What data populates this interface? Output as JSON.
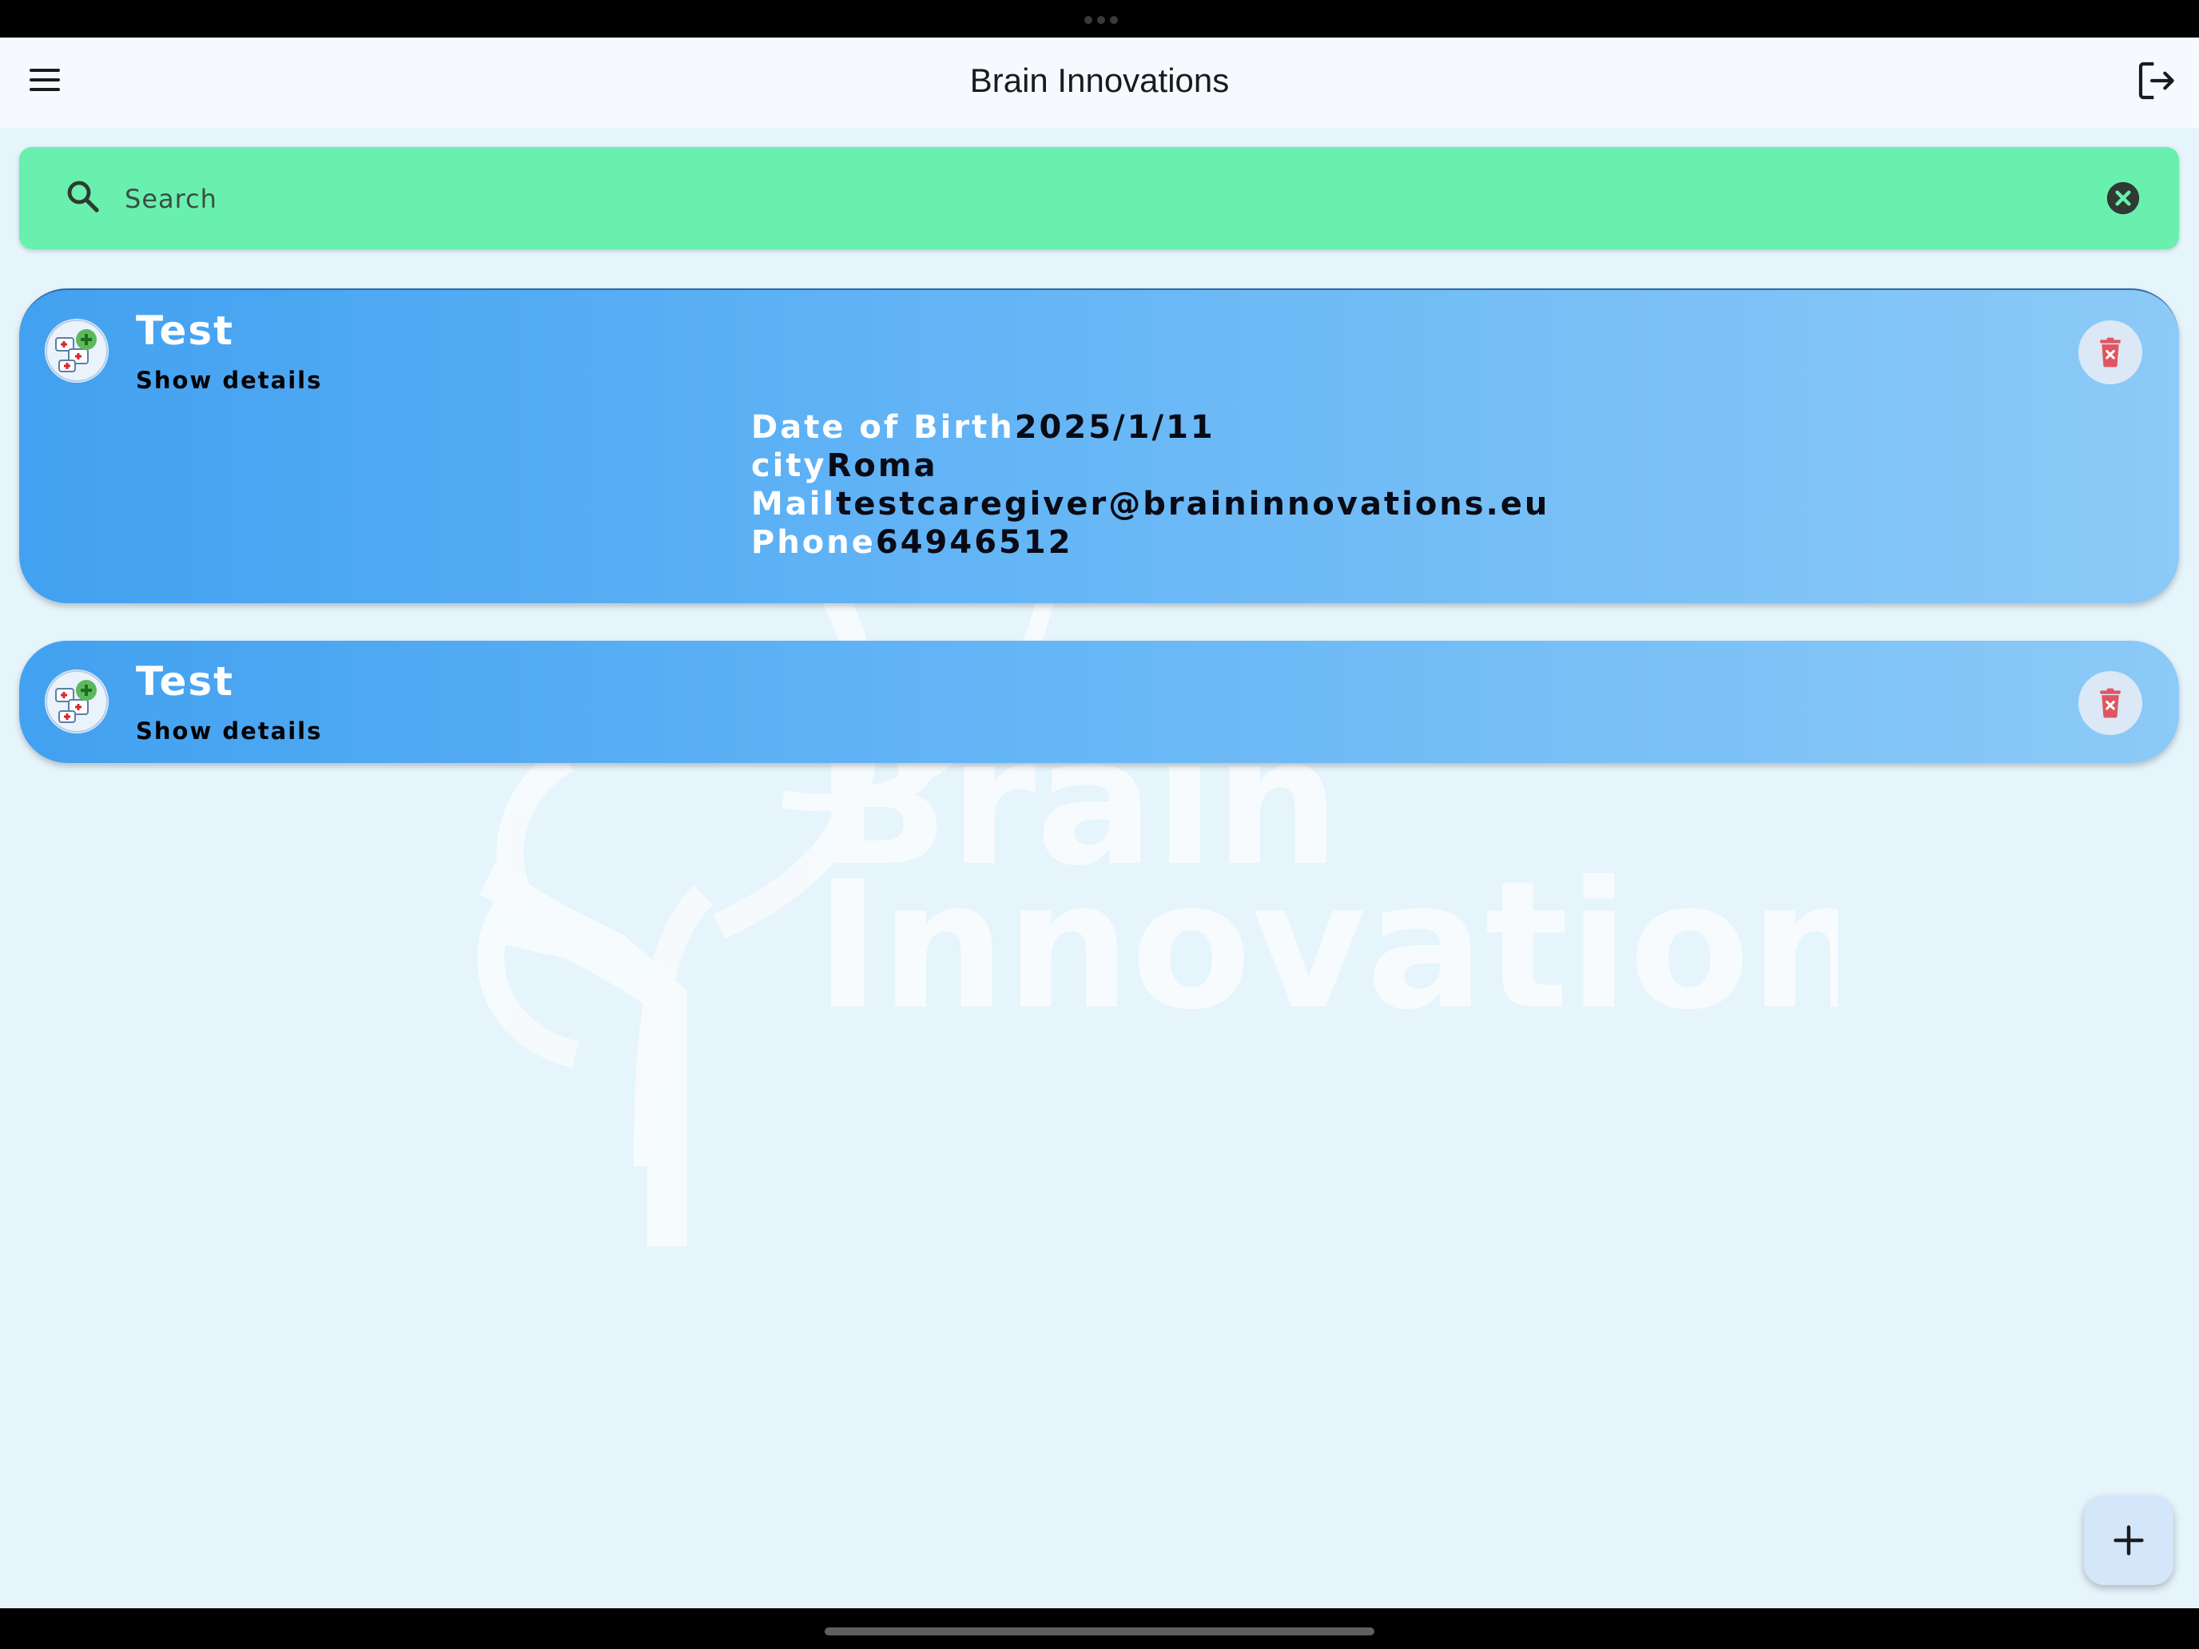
{
  "app_bar": {
    "title": "Brain Innovations",
    "menu_icon": "menu-icon",
    "logout_icon": "logout-icon"
  },
  "watermark": {
    "line1": "Brain",
    "line2": "Innovations"
  },
  "search": {
    "placeholder": "Search",
    "value": "",
    "icon": "search-icon",
    "clear_icon": "clear-icon"
  },
  "cards": [
    {
      "name": "Test",
      "toggle_label": "Show details",
      "expanded": true,
      "details": [
        {
          "label": "Date of Birth",
          "value": "2025/1/11"
        },
        {
          "label": "city",
          "value": "Roma"
        },
        {
          "label": "Mail",
          "value": "testcaregiver@braininnovations.eu"
        },
        {
          "label": "Phone",
          "value": "64946512"
        }
      ]
    },
    {
      "name": "Test",
      "toggle_label": "Show details",
      "expanded": false
    }
  ],
  "fab": {
    "icon": "plus-icon"
  },
  "colors": {
    "search_bg": "#69f0ae",
    "card_gradient_start": "#42a1f0",
    "card_gradient_end": "#8ccaf7",
    "background": "#e6f4fc",
    "delete_icon": "#e05561"
  }
}
